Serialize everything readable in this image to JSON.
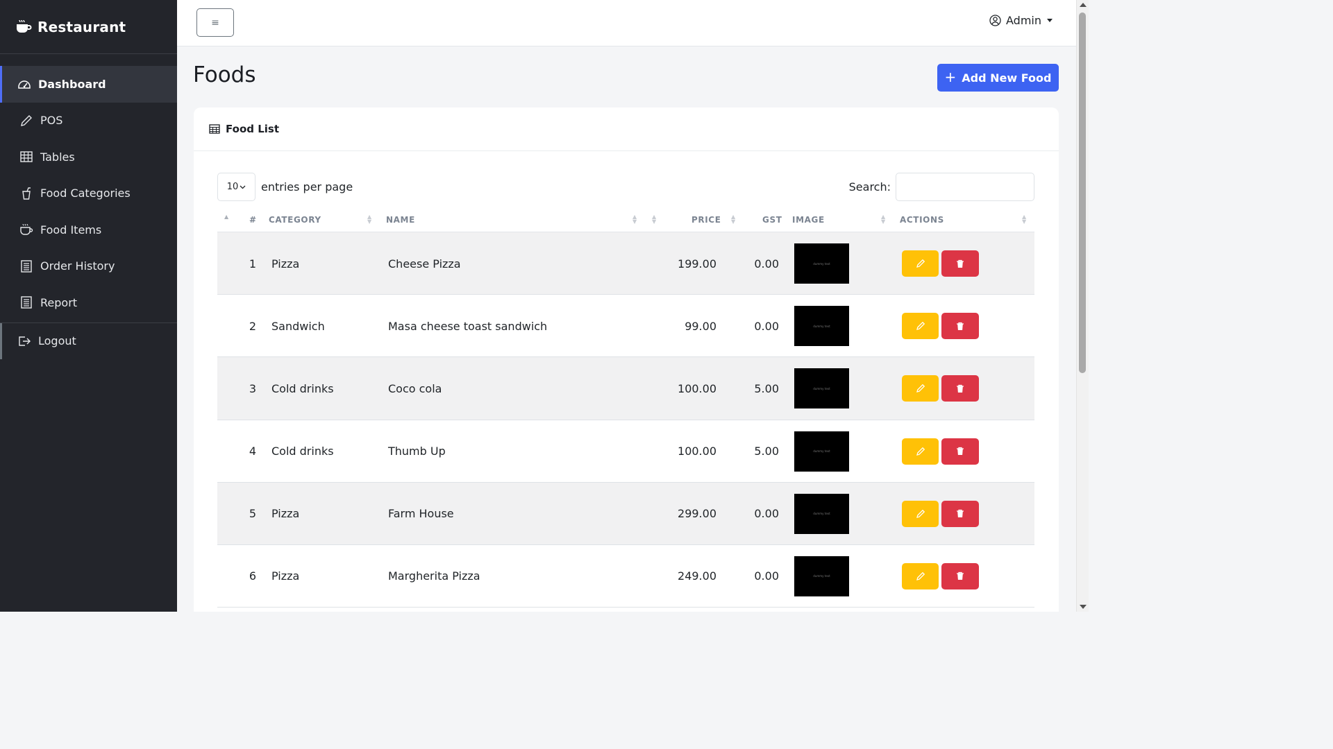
{
  "brand": {
    "name": "Restaurant",
    "icon": "coffee-cup-icon"
  },
  "sidebar": {
    "items": [
      {
        "label": "Dashboard",
        "icon": "gauge-icon",
        "active": true
      },
      {
        "label": "POS",
        "icon": "pencil-icon"
      },
      {
        "label": "Tables",
        "icon": "table-grid-icon"
      },
      {
        "label": "Food Categories",
        "icon": "cup-straw-icon"
      },
      {
        "label": "Food Items",
        "icon": "cup-hot-icon"
      },
      {
        "label": "Order History",
        "icon": "list-icon"
      },
      {
        "label": "Report",
        "icon": "report-icon"
      }
    ],
    "logout": {
      "label": "Logout",
      "icon": "logout-icon"
    }
  },
  "topbar": {
    "toggle_glyph": "≡",
    "user_label": "Admin"
  },
  "main": {
    "title": "Foods",
    "add_button_label": "Add New Food",
    "add_button_glyph": "+"
  },
  "card": {
    "title": "Food List",
    "entries_value": "10",
    "entries_label": "entries per page",
    "search_label": "Search:",
    "search_value": ""
  },
  "table": {
    "headers": {
      "num": "#",
      "category": "CATEGORY",
      "name": "NAME",
      "price": "PRICE",
      "gst": "GST",
      "image": "IMAGE",
      "actions": "ACTIONS"
    },
    "rows": [
      {
        "num": "1",
        "category": "Pizza",
        "name": "Cheese Pizza",
        "price": "199.00",
        "gst": "0.00",
        "image_text": "dummy text"
      },
      {
        "num": "2",
        "category": "Sandwich",
        "name": "Masa cheese toast sandwich",
        "price": "99.00",
        "gst": "0.00",
        "image_text": "dummy text"
      },
      {
        "num": "3",
        "category": "Cold drinks",
        "name": "Coco cola",
        "price": "100.00",
        "gst": "5.00",
        "image_text": "dummy text"
      },
      {
        "num": "4",
        "category": "Cold drinks",
        "name": "Thumb Up",
        "price": "100.00",
        "gst": "5.00",
        "image_text": "dummy text"
      },
      {
        "num": "5",
        "category": "Pizza",
        "name": "Farm House",
        "price": "299.00",
        "gst": "0.00",
        "image_text": "dummy text"
      },
      {
        "num": "6",
        "category": "Pizza",
        "name": "Margherita Pizza",
        "price": "249.00",
        "gst": "0.00",
        "image_text": "dummy text"
      }
    ]
  },
  "colors": {
    "sidebar_bg": "#23252b",
    "primary": "#3d63f2",
    "warning": "#ffc107",
    "danger": "#dc3545",
    "active_accent": "#4f6ef7"
  }
}
